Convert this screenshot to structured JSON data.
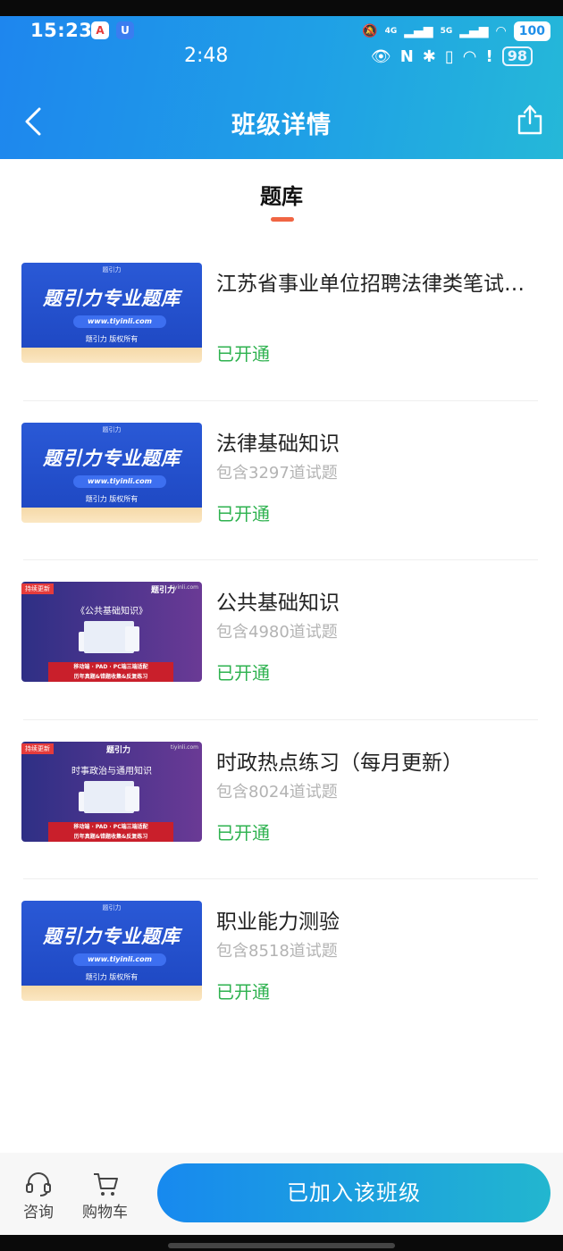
{
  "status_bar": {
    "time": "15:23",
    "time2": "2:48",
    "app_icon1": "A",
    "app_icon2": "U",
    "net1": "4G",
    "net2": "5G",
    "battery1": "100",
    "battery2": "98"
  },
  "header": {
    "title": "班级详情"
  },
  "tab": {
    "label": "题库"
  },
  "thumb_text": {
    "brand": "题引力",
    "main": "题引力专业题库",
    "url": "www.tiyinli.com",
    "copyright": "题引力 版权所有",
    "badge": "持续更新",
    "logo": "题引力",
    "site": "tiyinli.com",
    "band1": "移动端 · PAD · PC端三端适配",
    "band2": "历年真题&错题收集&反复练习"
  },
  "items": [
    {
      "title": "江苏省事业单位招聘法律类笔试题库",
      "sub": "",
      "status": "已开通",
      "thumb": "blue"
    },
    {
      "title": "法律基础知识",
      "sub": "包含3297道试题",
      "status": "已开通",
      "thumb": "blue"
    },
    {
      "title": "公共基础知识",
      "sub": "包含4980道试题",
      "status": "已开通",
      "thumb": "purple",
      "thumb_title": "《公共基础知识》"
    },
    {
      "title": "时政热点练习（每月更新）",
      "sub": "包含8024道试题",
      "status": "已开通",
      "thumb": "purple",
      "thumb_title": "时事政治与通用知识"
    },
    {
      "title": "职业能力测验",
      "sub": "包含8518道试题",
      "status": "已开通",
      "thumb": "blue"
    }
  ],
  "bottom": {
    "consult": "咨询",
    "cart": "购物车",
    "join": "已加入该班级"
  }
}
